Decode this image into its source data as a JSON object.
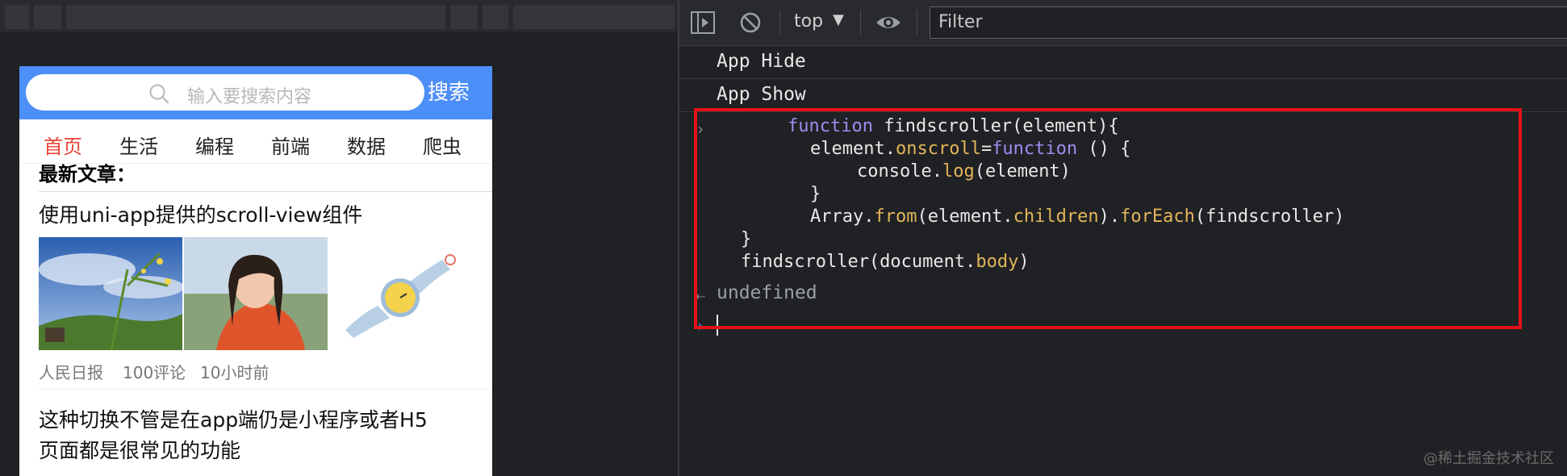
{
  "phone": {
    "search_placeholder": "输入要搜索内容",
    "search_button": "搜索",
    "tabs": [
      {
        "label": "首页",
        "active": true
      },
      {
        "label": "生活",
        "active": false
      },
      {
        "label": "编程",
        "active": false
      },
      {
        "label": "前端",
        "active": false
      },
      {
        "label": "数据",
        "active": false
      },
      {
        "label": "爬虫",
        "active": false
      }
    ],
    "section_title": "最新文章：",
    "article1": {
      "title": "使用uni-app提供的scroll-view组件",
      "source": "人民日报",
      "comments": "100评论",
      "time": "10小时前"
    },
    "article2": {
      "title_line1": "这种切换不管是在app端仍是小程序或者H5",
      "title_line2": "页面都是很常见的功能"
    }
  },
  "console": {
    "context": "top",
    "filter_placeholder": "Filter",
    "messages": [
      "App Hide",
      "App Show"
    ],
    "result": "undefined"
  },
  "code": {
    "l1_kw": "function",
    "l1_rest": " findscroller(element){",
    "l2_a": "element.",
    "l2_prop": "onscroll",
    "l2_eq": "=",
    "l2_kw": "function",
    "l2_rest": " () {",
    "l3_a": "console.",
    "l3_prop": "log",
    "l3_rest": "(element)",
    "l4": "}",
    "l5_a": "Array.",
    "l5_from": "from",
    "l5_b": "(element.",
    "l5_children": "children",
    "l5_c": ").",
    "l5_foreach": "forEach",
    "l5_d": "(findscroller)",
    "l6": "}",
    "l7_a": "findscroller(document.",
    "l7_body": "body",
    "l7_b": ")"
  },
  "colors": {
    "accent_blue": "#4d8ff8",
    "active_tab": "#e8443a",
    "highlight_red": "#e3111a"
  },
  "watermark": "@稀土掘金技术社区"
}
